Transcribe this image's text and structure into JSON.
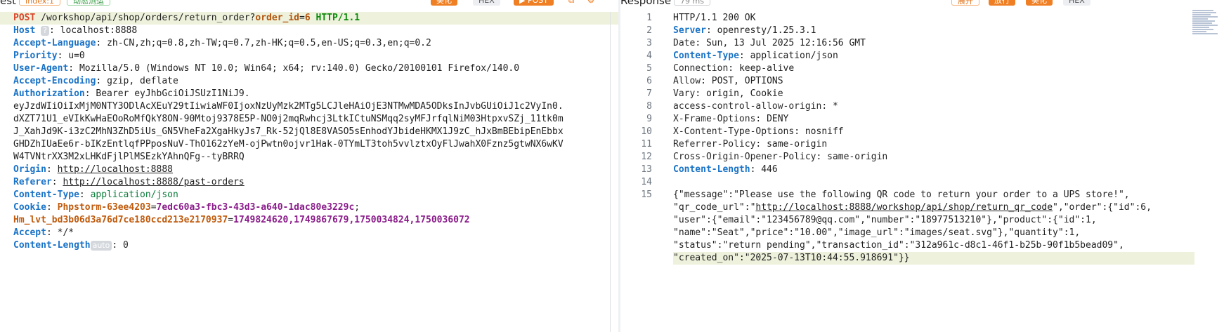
{
  "request": {
    "title": "est",
    "chips": {
      "index_tag": "Index:1",
      "auto_tag": "动态测运",
      "action_label": "美化",
      "hex_label": "HEX",
      "send_label": "▶ POST"
    },
    "request_line": {
      "method": "POST",
      "path": "/workshop/api/shop/orders/return_order?",
      "param": "order_id",
      "equals": "=",
      "value": "6",
      "protocol": "HTTP/1.1"
    },
    "host": {
      "name": "Host",
      "tag": "?",
      "sep": ":",
      "value": "localhost:8888"
    },
    "headers": [
      {
        "name": "Accept-Language",
        "value": "zh-CN,zh;q=0.8,zh-TW;q=0.7,zh-HK;q=0.5,en-US;q=0.3,en;q=0.2"
      },
      {
        "name": "Priority",
        "value": "u=0"
      },
      {
        "name": "User-Agent",
        "value": "Mozilla/5.0 (Windows NT 10.0; Win64; x64; rv:140.0) Gecko/20100101 Firefox/140.0"
      },
      {
        "name": "Accept-Encoding",
        "value": "gzip, deflate"
      }
    ],
    "authorization": {
      "name": "Authorization",
      "value": "Bearer eyJhbGciOiJSUzI1NiJ9.",
      "continuation": [
        "eyJzdWIiOiIxMjM0NTY3ODlAcXEuY29tIiwiaWF0IjoxNzUyMzk2MTg5LCJleHAiOjE3NTMwMDA5ODksInJvbGUiOiJ1c2VyIn0.",
        "dXZT71U1_eVIkKwHaEOoRoMfQkY8ON-90Mtoj9378E5P-NO0j2mqRwhcj3LtkICtuNSMqq2syMFJrfqlNiM03HtpxvSZj_11tk0m",
        "J_XahJd9K-i3zC2MhN3ZhD5iUs_GN5VheFa2XgaHkyJs7_Rk-52jQl8E8VASO5sEnhodYJbideHKMX1J9zC_hJxBmBEbipEnEbbx",
        "GHDZhIUaEe6r-bIKzEntlqfPPposNuV-ThO162zYeM-ojPwtn0ojvr1Hak-0TYmLT3toh5vvlztxOyFlJwahX0Fznz5gtwNX6wKV",
        "W4TVNtrXX3M2xLHKdFjlPlMSEzkYAhnQFg--tyBRRQ"
      ]
    },
    "origin": {
      "name": "Origin",
      "value": "http://localhost:8888"
    },
    "referer": {
      "name": "Referer",
      "value": "http://localhost:8888/past-orders"
    },
    "content_type": {
      "name": "Content-Type",
      "value": "application/json"
    },
    "cookie": {
      "name": "Cookie",
      "c1_name": "Phpstorm-63ee4203",
      "c1_value": "7edc60a3-fbc3-43d3-a640-1dac80e3229c",
      "c2_name": "Hm_lvt_bd3b06d3a76d7ce180ccd213e2170937",
      "c2_value": "1749824620,1749867679,1750034824,1750036072"
    },
    "accept": {
      "name": "Accept",
      "value": "*/*"
    },
    "content_length": {
      "name": "Content-Length",
      "tag": "auto",
      "value": "0"
    }
  },
  "response": {
    "title": "Response",
    "time_tag": "79 ms",
    "chips": {
      "expand_label": "展开",
      "release_label": "放行",
      "beautify_label": "美化",
      "hex_label": "HEX"
    },
    "line_numbers": [
      "1",
      "2",
      "3",
      "4",
      "5",
      "6",
      "7",
      "8",
      "9",
      "10",
      "11",
      "12",
      "13",
      "14",
      "15"
    ],
    "status_line": "HTTP/1.1 200 OK",
    "headers": [
      {
        "name": "Server",
        "value": "openresty/1.25.3.1",
        "bold": true
      },
      {
        "name": "Date",
        "value": "Sun, 13 Jul 2025 12:16:56 GMT",
        "bold": false
      },
      {
        "name": "Content-Type",
        "value": "application/json",
        "bold": true
      },
      {
        "name": "Connection",
        "value": "keep-alive",
        "bold": false
      },
      {
        "name": "Allow",
        "value": "POST, OPTIONS",
        "bold": false
      },
      {
        "name": "Vary",
        "value": "origin, Cookie",
        "bold": false
      },
      {
        "name": "access-control-allow-origin",
        "value": "*",
        "bold": false
      },
      {
        "name": "X-Frame-Options",
        "value": "DENY",
        "bold": false
      },
      {
        "name": "X-Content-Type-Options",
        "value": "nosniff",
        "bold": false
      },
      {
        "name": "Referrer-Policy",
        "value": "same-origin",
        "bold": false
      },
      {
        "name": "Cross-Origin-Opener-Policy",
        "value": "same-origin",
        "bold": false
      },
      {
        "name": "Content-Length",
        "value": "446",
        "bold": true
      }
    ],
    "body": {
      "l1": "{\"message\":\"Please use the following QR code to return your order to a UPS store!\",",
      "l2_pre": "\"qr_code_url\":\"",
      "l2_link": "http://localhost:8888/workshop/api/shop/return_qr_code",
      "l2_post": "\",\"order\":{\"id\":6,",
      "l3": "\"user\":{\"email\":\"123456789@qq.com\",\"number\":\"18977513210\"},\"product\":{\"id\":1,",
      "l4": "\"name\":\"Seat\",\"price\":\"10.00\",\"image_url\":\"images/seat.svg\"},\"quantity\":1,",
      "l5": "\"status\":\"return pending\",\"transaction_id\":\"312a961c-d8c1-46f1-b25b-90f1b5bead09\",",
      "l6": "\"created_on\":\"2025-07-13T10:44:55.918691\"}}"
    }
  }
}
